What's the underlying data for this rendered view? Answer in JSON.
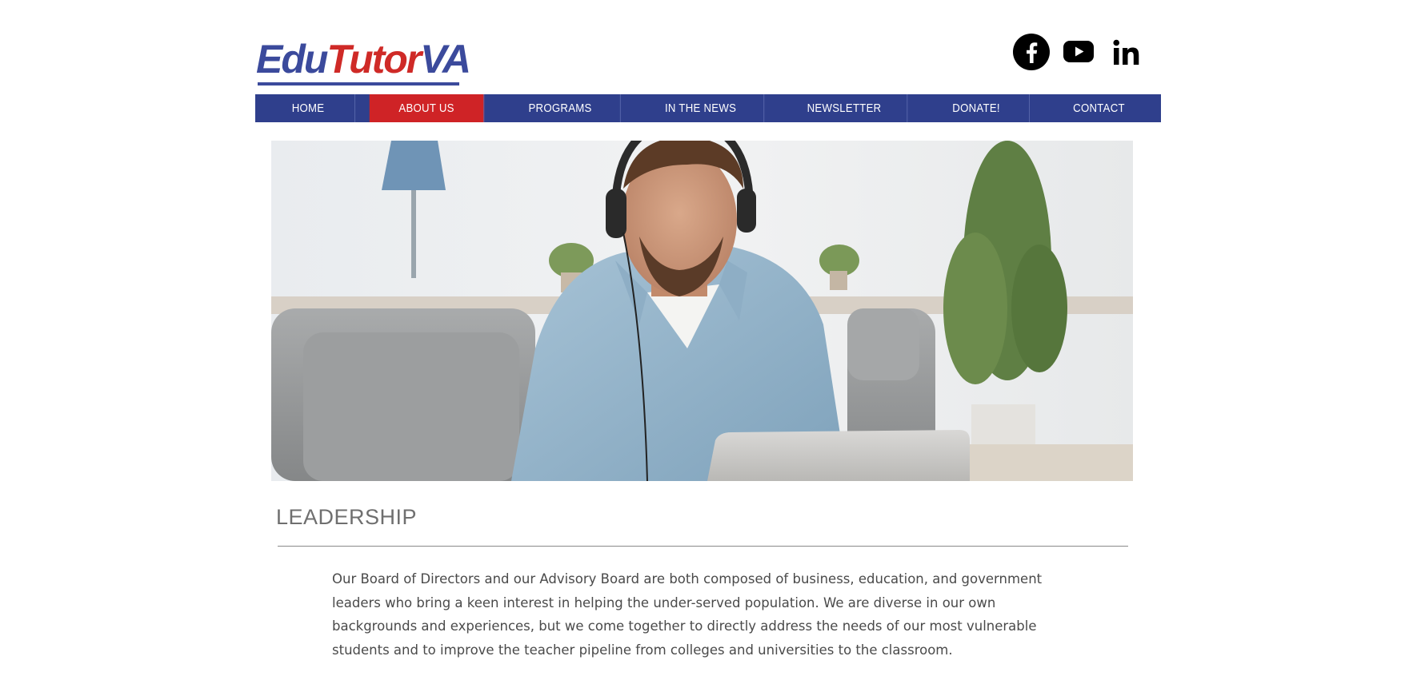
{
  "logo": {
    "part1": "Edu",
    "part2": "Tutor",
    "part3": "VA",
    "colors": {
      "blue": "#3b4a9c",
      "red": "#cf2a27"
    }
  },
  "social": [
    {
      "icon": "facebook-icon"
    },
    {
      "icon": "youtube-icon"
    },
    {
      "icon": "linkedin-icon"
    }
  ],
  "nav": {
    "items": [
      {
        "label": "HOME"
      },
      {
        "label": "ABOUT US",
        "active": true
      },
      {
        "label": "PROGRAMS"
      },
      {
        "label": "IN THE NEWS"
      },
      {
        "label": "NEWSLETTER"
      },
      {
        "label": "DONATE!"
      },
      {
        "label": "CONTACT"
      }
    ],
    "colors": {
      "background": "#2f3f8c",
      "active": "#cf2326"
    }
  },
  "hero": {
    "subject": "man-with-headphones-at-laptop"
  },
  "leadership": {
    "heading": "LEADERSHIP",
    "lines": [
      "Our Board of Directors and our Advisory Board are both composed of business, education, and government",
      "leaders who bring a keen interest in helping the under-served population. We are diverse in our own",
      "backgrounds and experiences, but we come together to directly address the needs of our most vulnerable",
      "students and to improve the teacher pipeline from colleges and universities to the classroom."
    ]
  }
}
